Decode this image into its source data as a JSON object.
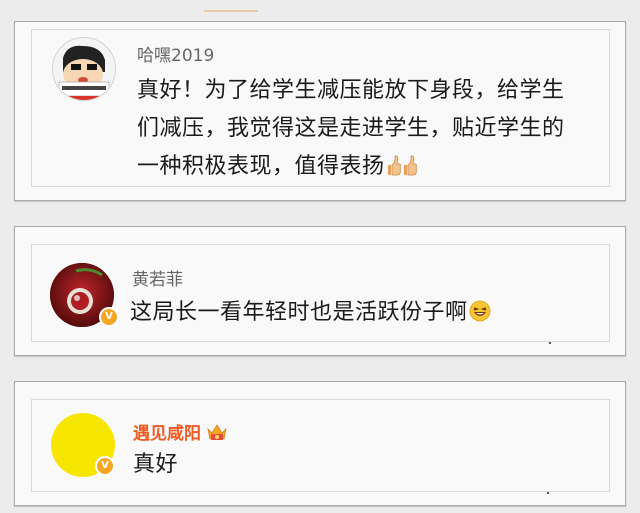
{
  "comments": [
    {
      "username": "哈嘿2019",
      "text_lines": [
        "真好！为了给学生减压能放下身段，给学生",
        "们减压，我觉得这是走进学生，贴近学生的",
        "一种积极表现，值得表扬"
      ],
      "trailing_emoji": "thumbs-up-icon",
      "verified": false
    },
    {
      "username": "黄若菲",
      "text_lines": [
        "这局长一看年轻时也是活跃份子啊"
      ],
      "trailing_emoji": "laughing-face-icon",
      "verified": true,
      "verified_badge": "V"
    },
    {
      "username": "遇见咸阳",
      "text_lines": [
        "真好"
      ],
      "verified": true,
      "verified_badge": "V",
      "name_badge": "crown-badge-icon"
    }
  ],
  "colors": {
    "username_gray": "#666666",
    "username_orange": "#f05a23",
    "verified_badge": "#f5a623",
    "comment_text": "#1a1a1a"
  }
}
